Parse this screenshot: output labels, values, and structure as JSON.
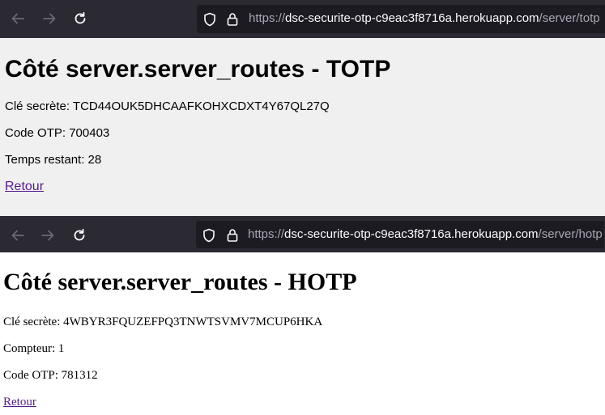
{
  "totp_window": {
    "url": {
      "prefix": "https://",
      "domain": "dsc-securite-otp-c9eac3f8716a.herokuapp.com",
      "path": "/server/totp"
    },
    "heading": "Côté server.server_routes - TOTP",
    "secret": "Clé secrète: TCD44OUK5DHCAAFKOHXCDXT4Y67QL27Q",
    "otp": "Code OTP: 700403",
    "remaining": "Temps restant: 28",
    "back_link": "Retour"
  },
  "hotp_window": {
    "url": {
      "prefix": "https://",
      "domain": "dsc-securite-otp-c9eac3f8716a.herokuapp.com",
      "path": "/server/hotp"
    },
    "heading": "Côté server.server_routes - HOTP",
    "secret": "Clé secrète: 4WBYR3FQUZEFPQ3TNWTSVMV7MCUP6HKA",
    "counter": "Compteur: 1",
    "otp": "Code OTP: 781312",
    "back_link": "Retour"
  },
  "colors": {
    "toolbar_bg": "#2b2a33",
    "urlbar_bg": "#1c1b22",
    "page1_bg": "#f0f0f0",
    "link": "#551a8b"
  },
  "icons": [
    "back-arrow-icon",
    "forward-arrow-icon",
    "reload-icon",
    "shield-icon",
    "lock-icon"
  ]
}
